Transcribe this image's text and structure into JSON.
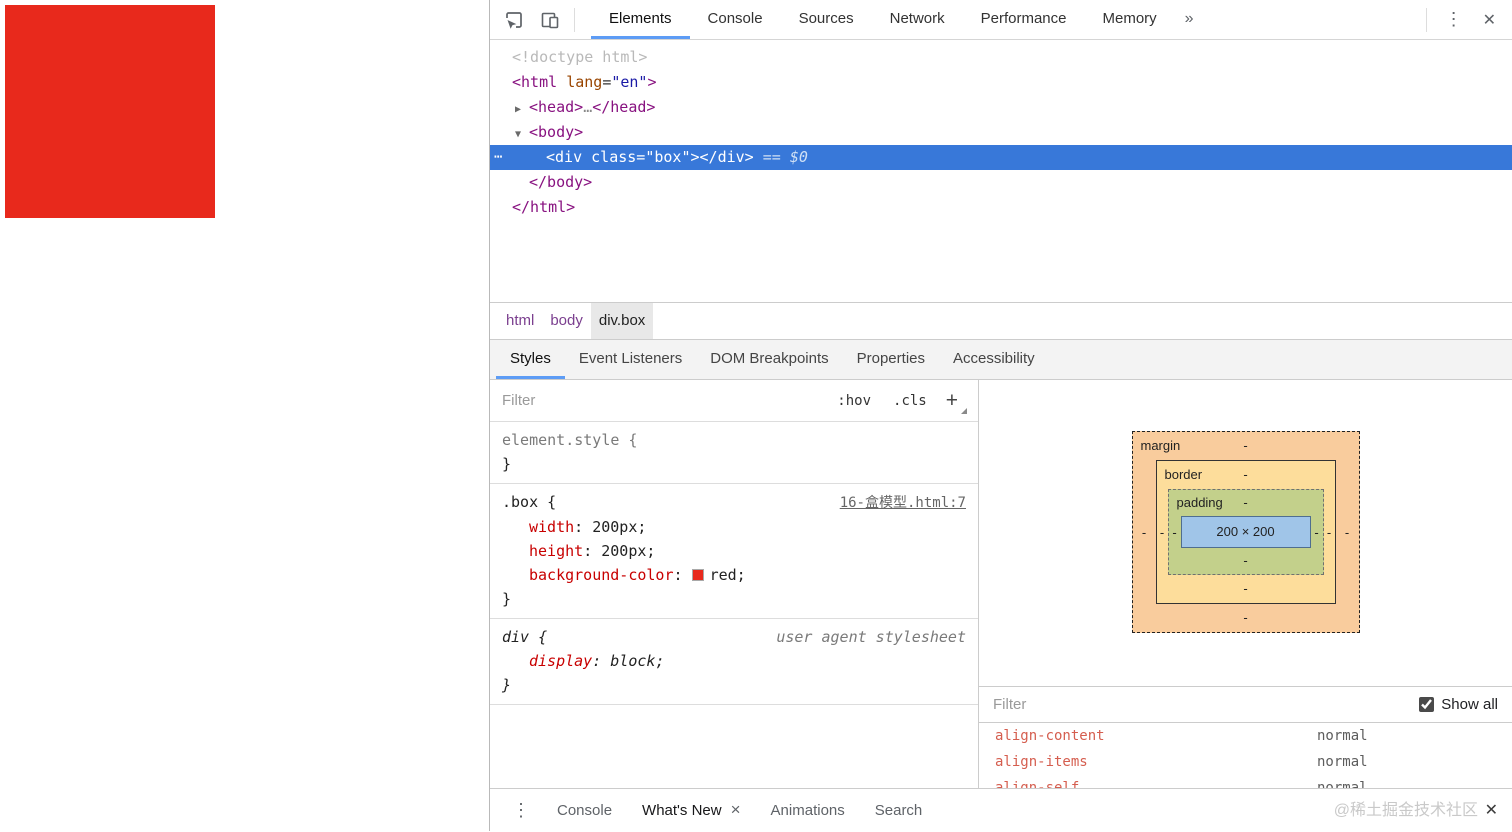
{
  "colors": {
    "red": "#e8291c",
    "selection": "#3878d9",
    "accent": "#5d9cf5"
  },
  "toolbar": {
    "inspect_icon": "inspect-icon",
    "device_icon": "device-toolbar-icon",
    "tabs": [
      {
        "label": "Elements",
        "active": true
      },
      {
        "label": "Console",
        "active": false
      },
      {
        "label": "Sources",
        "active": false
      },
      {
        "label": "Network",
        "active": false
      },
      {
        "label": "Performance",
        "active": false
      },
      {
        "label": "Memory",
        "active": false
      }
    ],
    "overflow_label": "»",
    "kebab": "⋮",
    "close": "✕"
  },
  "dom_tree": {
    "lines": [
      {
        "indent": 0,
        "tokens": [
          {
            "c": "doctype",
            "t": "<!doctype html>"
          }
        ]
      },
      {
        "indent": 0,
        "tokens": [
          {
            "c": "tag",
            "t": "<html "
          },
          {
            "c": "attr",
            "t": "lang"
          },
          {
            "c": "punct",
            "t": "="
          },
          {
            "c": "val",
            "t": "\"en\""
          },
          {
            "c": "tag",
            "t": ">"
          }
        ]
      },
      {
        "indent": 1,
        "arrow": "▶",
        "tokens": [
          {
            "c": "tag",
            "t": "<head>"
          },
          {
            "c": "dim",
            "t": "…"
          },
          {
            "c": "tag",
            "t": "</head>"
          }
        ]
      },
      {
        "indent": 1,
        "arrow": "▼",
        "tokens": [
          {
            "c": "tag",
            "t": "<body>"
          }
        ]
      },
      {
        "indent": 2,
        "selected": true,
        "gutter": "⋯",
        "tokens": [
          {
            "c": "sel",
            "t": "<div class=\"box\"></div>"
          },
          {
            "c": "eq",
            "t": " == "
          },
          {
            "c": "dollar",
            "t": "$0"
          }
        ]
      },
      {
        "indent": 1,
        "tokens": [
          {
            "c": "tag",
            "t": "</body>"
          }
        ]
      },
      {
        "indent": 0,
        "tokens": [
          {
            "c": "tag",
            "t": "</html>"
          }
        ]
      }
    ]
  },
  "breadcrumb": [
    {
      "label": "html",
      "selected": false
    },
    {
      "label": "body",
      "selected": false
    },
    {
      "label": "div.box",
      "selected": true
    }
  ],
  "sidebar_tabs": [
    {
      "label": "Styles",
      "active": true
    },
    {
      "label": "Event Listeners",
      "active": false
    },
    {
      "label": "DOM Breakpoints",
      "active": false
    },
    {
      "label": "Properties",
      "active": false
    },
    {
      "label": "Accessibility",
      "active": false
    }
  ],
  "styles": {
    "filter_placeholder": "Filter",
    "pseudo_button": ":hov",
    "class_button": ".cls",
    "new_rule_button": "+",
    "brace_open": " {",
    "brace_close": "}",
    "colon": ": ",
    "semicolon": ";",
    "sections": [
      {
        "selector": "element.style",
        "gray": true,
        "properties": []
      },
      {
        "selector": ".box",
        "link": "16-盒模型.html:7",
        "properties": [
          {
            "name": "width",
            "value": "200px"
          },
          {
            "name": "height",
            "value": "200px"
          },
          {
            "name": "background-color",
            "value": "red",
            "swatch": "#e8291c"
          }
        ]
      },
      {
        "selector": "div",
        "note": "user agent stylesheet",
        "italic": true,
        "properties": [
          {
            "name": "display",
            "value": "block"
          }
        ]
      }
    ]
  },
  "box_model": {
    "margin_label": "margin",
    "border_label": "border",
    "padding_label": "padding",
    "content": "200 × 200",
    "dash": "-"
  },
  "computed": {
    "filter_placeholder": "Filter",
    "show_all_label": "Show all",
    "show_all_checked": true,
    "rows": [
      {
        "name": "align-content",
        "value": "normal"
      },
      {
        "name": "align-items",
        "value": "normal"
      },
      {
        "name": "align-self",
        "value": "normal"
      }
    ]
  },
  "drawer": {
    "kebab": "⋮",
    "close_tab_glyph": "×",
    "tabs": [
      {
        "label": "Console",
        "active": false
      },
      {
        "label": "What's New",
        "active": true,
        "closable": true
      },
      {
        "label": "Animations",
        "active": false
      },
      {
        "label": "Search",
        "active": false
      }
    ],
    "close": "✕"
  },
  "watermark": "@稀土掘金技术社区"
}
